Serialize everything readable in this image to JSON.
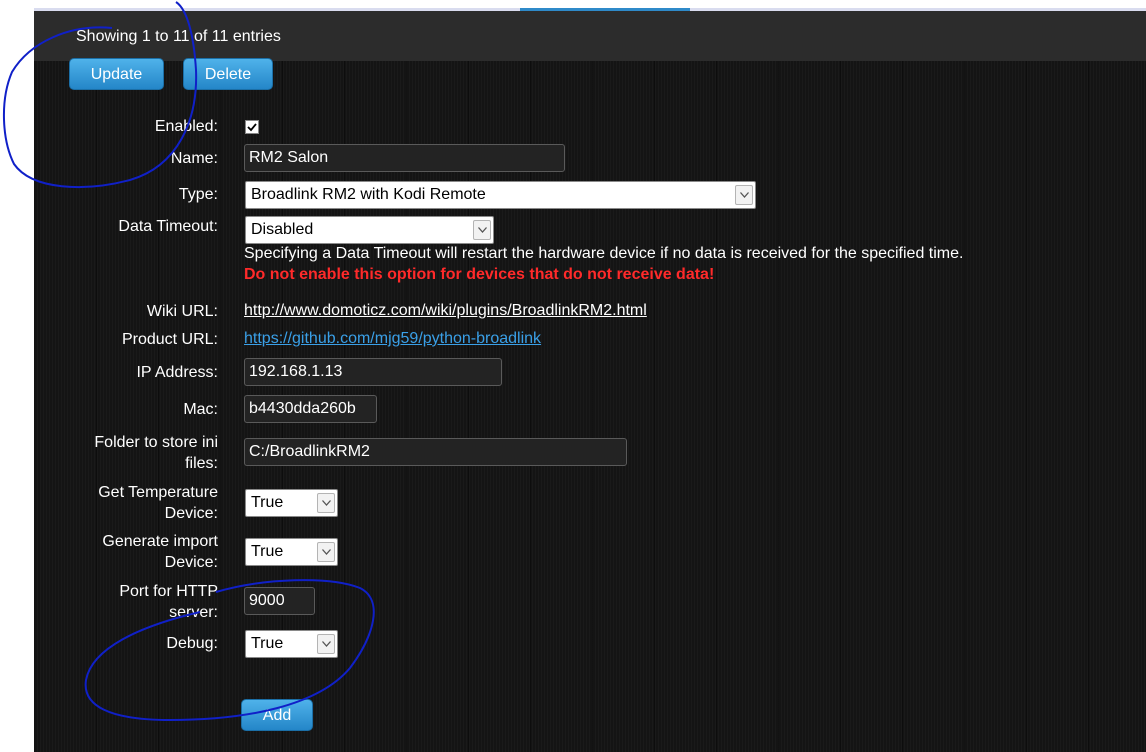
{
  "header": {
    "info_text": "Showing 1 to 11 of 11 entries",
    "update_label": "Update",
    "delete_label": "Delete"
  },
  "form": {
    "enabled": {
      "label": "Enabled:",
      "checked": true
    },
    "name": {
      "label": "Name:",
      "value": "RM2 Salon"
    },
    "type": {
      "label": "Type:",
      "value": "Broadlink RM2 with Kodi Remote"
    },
    "data_timeout": {
      "label": "Data Timeout:",
      "value": "Disabled",
      "help": "Specifying a Data Timeout will restart the hardware device if no data is received for the specified time.",
      "warning": "Do not enable this option for devices that do not receive data!"
    },
    "wiki_url": {
      "label": "Wiki URL:",
      "value": "http://www.domoticz.com/wiki/plugins/BroadlinkRM2.html"
    },
    "product_url": {
      "label": "Product URL:",
      "value": "https://github.com/mjg59/python-broadlink"
    },
    "ip_address": {
      "label": "IP Address:",
      "value": "192.168.1.13"
    },
    "mac": {
      "label": "Mac:",
      "value": "b4430dda260b"
    },
    "folder": {
      "label_line1": "Folder to store ini",
      "label_line2": "files:",
      "value": "C:/BroadlinkRM2"
    },
    "get_temp": {
      "label_line1": "Get Temperature",
      "label_line2": "Device:",
      "value": "True"
    },
    "gen_import": {
      "label_line1": "Generate import",
      "label_line2": "Device:",
      "value": "True"
    },
    "http_port": {
      "label_line1": "Port for HTTP",
      "label_line2": "server:",
      "value": "9000"
    },
    "debug": {
      "label": "Debug:",
      "value": "True"
    },
    "add_label": "Add"
  },
  "colors": {
    "accent": "#2f8ac9",
    "warning": "#ff2a2a",
    "link_blue": "#3aa0e8",
    "annotation_ink": "#1020c8"
  }
}
